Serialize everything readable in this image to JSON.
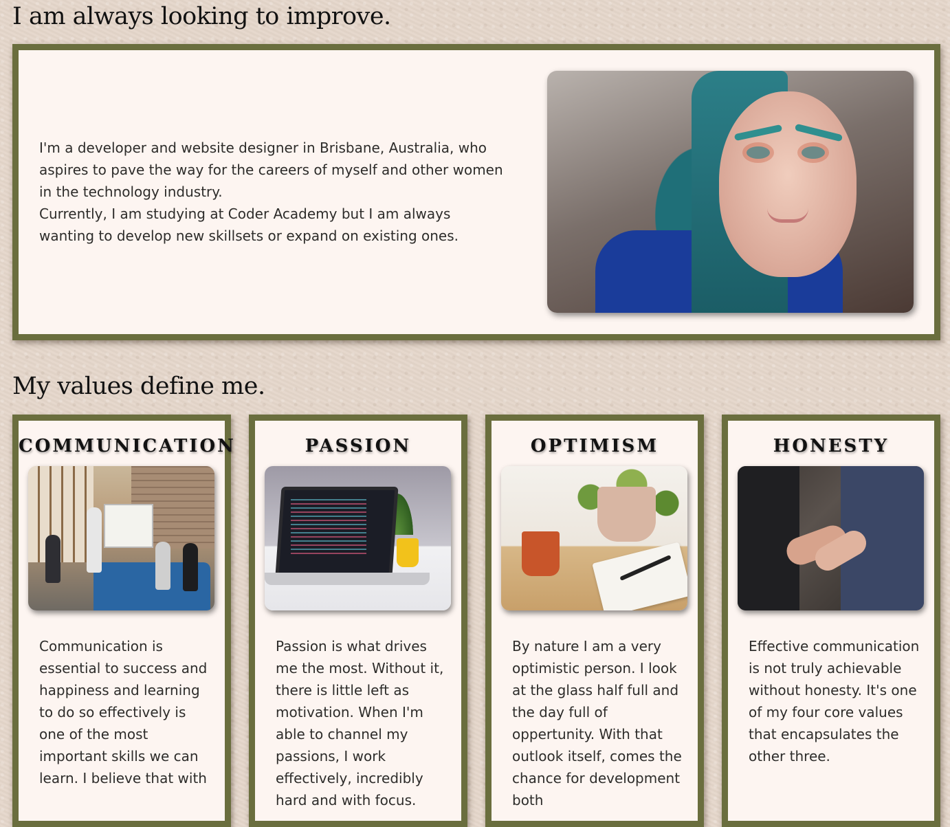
{
  "about": {
    "heading": "I am always looking to improve.",
    "paragraph_1": "I'm a developer and website designer in Brisbane, Australia, who aspires to pave the way for the careers of myself and other women in the technology industry.",
    "paragraph_2": "Currently, I am studying at Coder Academy but I am always wanting to develop new skillsets or expand on existing ones."
  },
  "values": {
    "heading": "My values define me.",
    "cards": [
      {
        "title": "COMMUNICATION",
        "text": "Communication is essential to success and happiness and learning to do so effectively is one of the most important skills we can learn. I believe that with"
      },
      {
        "title": "PASSION",
        "text": "Passion is what drives me the most. Without it, there is little left as motivation. When I'm able to channel my passions, I work effectively, incredibly hard and with focus."
      },
      {
        "title": "OPTIMISM",
        "text": "By nature I am a very optimistic person. I look at the glass half full and the day full of oppertunity. With that outlook itself, comes the chance for development both"
      },
      {
        "title": "HONESTY",
        "text": "Effective communication is not truly achievable without honesty. It's one of my four core values that encapsulates the other three."
      }
    ]
  },
  "colors": {
    "page_background": "#e4d6ca",
    "panel_background": "#fdf5f1",
    "panel_border": "#6a6e3e",
    "heading_text": "#111111",
    "body_text": "#2d2c2a"
  }
}
